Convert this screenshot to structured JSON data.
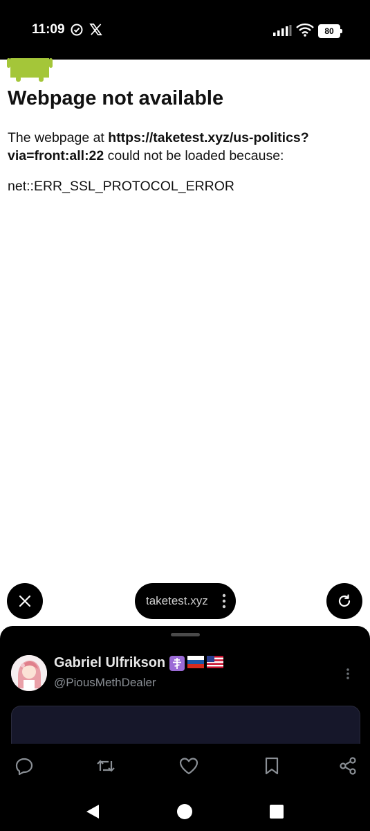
{
  "status_bar": {
    "time": "11:09",
    "battery": "80",
    "icons": [
      "check-circle-icon",
      "x-logo-icon",
      "signal-icon",
      "wifi-icon",
      "battery-icon"
    ]
  },
  "error_page": {
    "icon": "android-robot-icon",
    "title": "Webpage not available",
    "body_prefix": "The webpage at ",
    "url": "https://taketest.xyz/us-politics?via=front:all:22",
    "body_suffix": " could not be loaded because:",
    "error_code": "net::ERR_SSL_PROTOCOL_ERROR"
  },
  "browser_controls": {
    "close_icon": "close-icon",
    "domain": "taketest.xyz",
    "menu_icon": "more-vertical-icon",
    "refresh_icon": "refresh-icon"
  },
  "post_sheet": {
    "display_name": "Gabriel Ulfrikson",
    "name_badges": "☦🇷🇺🇺🇸",
    "handle": "@PiousMethDealer",
    "actions": [
      "reply-icon",
      "retweet-icon",
      "like-icon",
      "bookmark-icon",
      "share-icon"
    ]
  },
  "nav_bar": {
    "buttons": [
      "back-icon",
      "home-icon",
      "recents-icon"
    ]
  },
  "colors": {
    "android_green": "#a4c639",
    "sheet_bg": "#000000",
    "media_bg": "#16172a",
    "text_muted": "#8a8f95"
  }
}
